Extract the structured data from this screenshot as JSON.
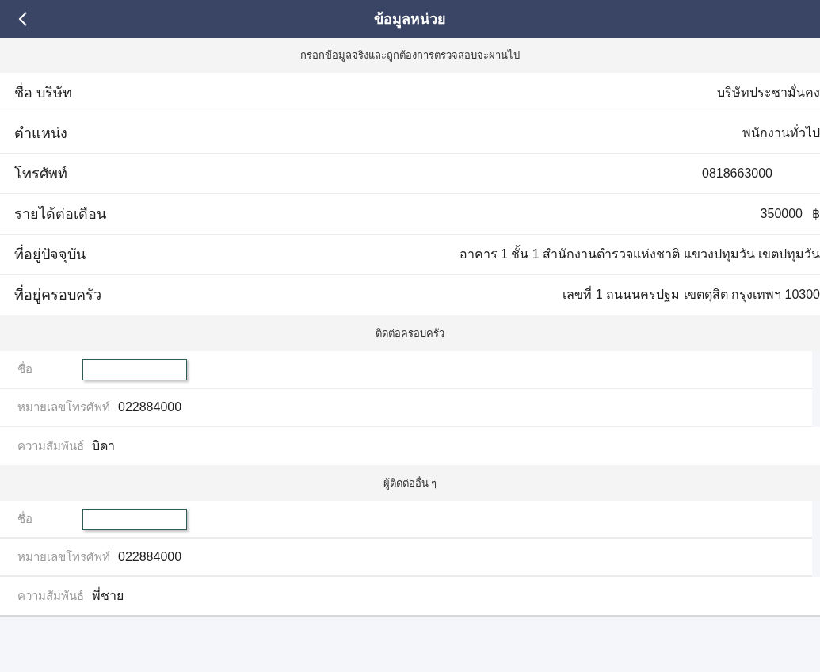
{
  "header": {
    "title": "ข้อมูลหน่วย"
  },
  "notice": "กรอกข้อมูลจริงและถูกต้องการตรวจสอบจะผ่านไป",
  "fields": [
    {
      "kind": "text",
      "label": "ชื่อ บริษัท",
      "value": "บริษัทประชามั่นคง"
    },
    {
      "kind": "text",
      "label": "ตำแหน่ง",
      "value": "พนักงานทั่วไป"
    },
    {
      "kind": "number",
      "label": "โทรศัพท์",
      "value": "0818663000"
    },
    {
      "kind": "currency",
      "label": "รายได้ต่อเดือน",
      "value": "350000",
      "unit": "฿"
    },
    {
      "kind": "text",
      "label": "ที่อยู่ปัจจุบัน",
      "value": "อาคาร 1 ชั้น 1 สำนักงานตำรวจแห่งชาติ แขวงปทุมวัน เขตปทุมวัน"
    },
    {
      "kind": "text",
      "label": "ที่อยู่ครอบครัว",
      "value": "เลขที่ 1 ถนนนครปฐม เขตดุสิต กรุงเทพฯ 10300"
    }
  ],
  "contacts": [
    {
      "title": "ติดต่อครอบครัว",
      "rows": [
        {
          "kind": "input",
          "label": "ชื่อ"
        },
        {
          "kind": "text",
          "label": "หมายเลขโทรศัพท์",
          "value": "022884000"
        },
        {
          "kind": "text",
          "label": "ความสัมพันธ์",
          "value": "บิดา"
        }
      ]
    },
    {
      "title": "ผู้ติดต่ออื่น ๆ",
      "rows": [
        {
          "kind": "input",
          "label": "ชื่อ"
        },
        {
          "kind": "text",
          "label": "หมายเลขโทรศัพท์",
          "value": "022884000"
        },
        {
          "kind": "text",
          "label": "ความสัมพันธ์",
          "value": "พี่ชาย"
        }
      ]
    }
  ]
}
